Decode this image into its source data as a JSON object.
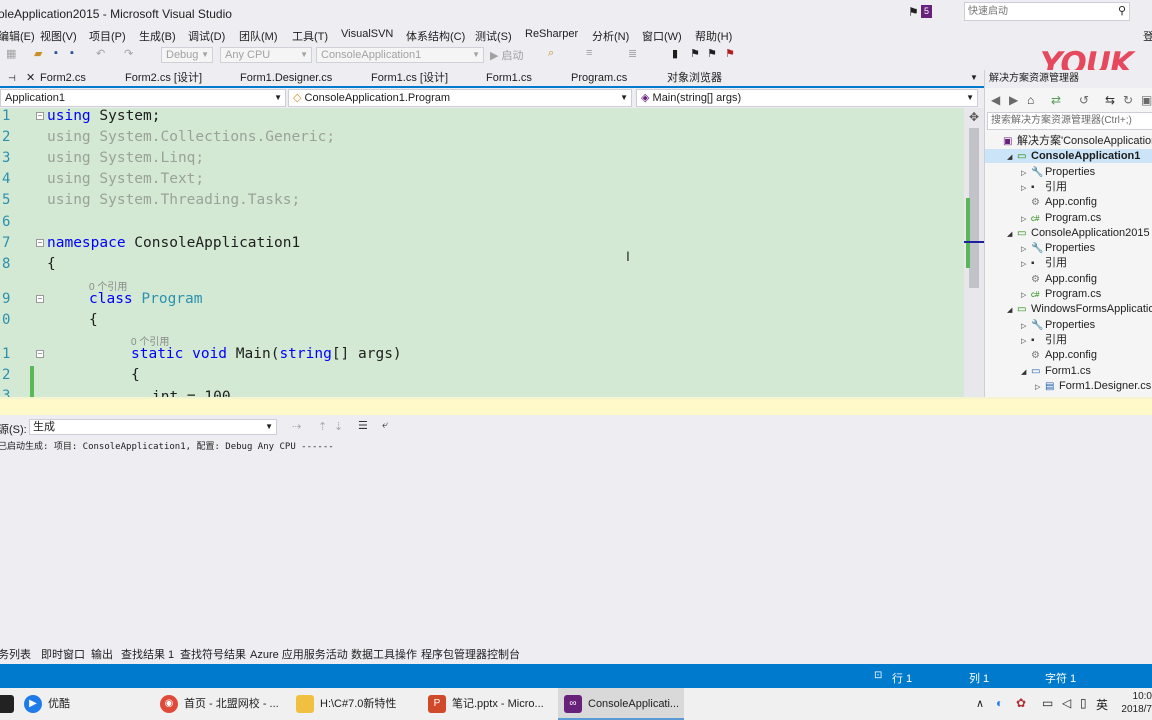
{
  "window": {
    "title": "oleApplication2015 - Microsoft Visual Studio",
    "notification_count": "5",
    "quick_launch_placeholder": "快速启动"
  },
  "menu": [
    "编辑(E)",
    "视图(V)",
    "项目(P)",
    "生成(B)",
    "调试(D)",
    "团队(M)",
    "工具(T)",
    "VisualSVN",
    "体系结构(C)",
    "测试(S)",
    "ReSharper",
    "分析(N)",
    "窗口(W)",
    "帮助(H)"
  ],
  "menu_right": "登",
  "toolbar": {
    "config": "Debug",
    "platform": "Any CPU",
    "project": "ConsoleApplication1",
    "start": "▶ 启动"
  },
  "watermark": "YOUK",
  "tabs": [
    "Form2.cs",
    "Form2.cs [设计]",
    "Form1.Designer.cs",
    "Form1.cs [设计]",
    "Form1.cs",
    "Program.cs",
    "对象浏览器"
  ],
  "navbar": {
    "project": "Application1",
    "class": "ConsoleApplication1.Program",
    "member": "Main(string[] args)"
  },
  "code": {
    "line_numbers": [
      "1",
      "2",
      "3",
      "4",
      "5",
      "6",
      "7",
      "8",
      "",
      "9",
      "0",
      "",
      "1",
      "2",
      "3"
    ],
    "lines": [
      {
        "kw": "using",
        "rest": " System;",
        "faded": false
      },
      {
        "kw": "using",
        "rest": " System.Collections.Generic;",
        "faded": true
      },
      {
        "kw": "using",
        "rest": " System.Linq;",
        "faded": true
      },
      {
        "kw": "using",
        "rest": " System.Text;",
        "faded": true
      },
      {
        "kw": "using",
        "rest": " System.Threading.Tasks;",
        "faded": true
      }
    ],
    "namespace_kw": "namespace",
    "namespace_name": " ConsoleApplication1",
    "open_brace": "{",
    "ref_count_1": "0 个引用",
    "class_kw": "class",
    "class_name": " Program",
    "ref_count_2": "0 个引用",
    "static_kw": "static",
    "void_kw": " void",
    "main_sig": " Main(",
    "string_kw": "string",
    "main_args": "[] args)",
    "partial_line": "int = 100"
  },
  "solution_explorer": {
    "title": "解决方案资源管理器",
    "search_placeholder": "搜索解决方案资源管理器(Ctrl+;)",
    "nodes": [
      {
        "label": "解决方案'ConsoleApplication",
        "indent": 0,
        "tri": "",
        "icon": "solution-icon",
        "bold": false
      },
      {
        "label": "ConsoleApplication1",
        "indent": 1,
        "tri": "◢",
        "icon": "csproj-icon",
        "bold": true
      },
      {
        "label": "Properties",
        "indent": 2,
        "tri": "▷",
        "icon": "wrench-icon",
        "bold": false
      },
      {
        "label": "引用",
        "indent": 2,
        "tri": "▷",
        "icon": "references-icon",
        "bold": false
      },
      {
        "label": "App.config",
        "indent": 2,
        "tri": "",
        "icon": "config-icon",
        "bold": false
      },
      {
        "label": "Program.cs",
        "indent": 2,
        "tri": "▷",
        "icon": "csharp-file-icon",
        "bold": false
      },
      {
        "label": "ConsoleApplication2015",
        "indent": 1,
        "tri": "◢",
        "icon": "csproj-icon",
        "bold": false
      },
      {
        "label": "Properties",
        "indent": 2,
        "tri": "▷",
        "icon": "wrench-icon",
        "bold": false
      },
      {
        "label": "引用",
        "indent": 2,
        "tri": "▷",
        "icon": "references-icon",
        "bold": false
      },
      {
        "label": "App.config",
        "indent": 2,
        "tri": "",
        "icon": "config-icon",
        "bold": false
      },
      {
        "label": "Program.cs",
        "indent": 2,
        "tri": "▷",
        "icon": "csharp-file-icon",
        "bold": false
      },
      {
        "label": "WindowsFormsApplicatio",
        "indent": 1,
        "tri": "◢",
        "icon": "csproj-icon",
        "bold": false
      },
      {
        "label": "Properties",
        "indent": 2,
        "tri": "▷",
        "icon": "wrench-icon",
        "bold": false
      },
      {
        "label": "引用",
        "indent": 2,
        "tri": "▷",
        "icon": "references-icon",
        "bold": false
      },
      {
        "label": "App.config",
        "indent": 2,
        "tri": "",
        "icon": "config-icon",
        "bold": false
      },
      {
        "label": "Form1.cs",
        "indent": 2,
        "tri": "◢",
        "icon": "form-icon",
        "bold": false
      },
      {
        "label": "Form1.Designer.cs",
        "indent": 3,
        "tri": "▷",
        "icon": "designer-file-icon",
        "bold": false
      }
    ]
  },
  "output": {
    "label": "源(S):",
    "source": "生成",
    "text": "已启动生成: 项目: ConsoleApplication1, 配置: Debug Any CPU ------"
  },
  "bottom_tabs": [
    "务列表",
    "即时窗口",
    "输出",
    "查找结果 1",
    "查找符号结果",
    "Azure 应用服务活动",
    "数据工具操作",
    "程序包管理器控制台"
  ],
  "status": {
    "row": "行 1",
    "col": "列 1",
    "char": "字符 1"
  },
  "taskbar": {
    "items": [
      "优酷",
      "首页 - 北盟网校 - ...",
      "H:\\C#7.0新特性",
      "笔记.pptx - Micro...",
      "ConsoleApplicati..."
    ],
    "ime": "英",
    "time": "10:0",
    "date": "2018/7"
  }
}
